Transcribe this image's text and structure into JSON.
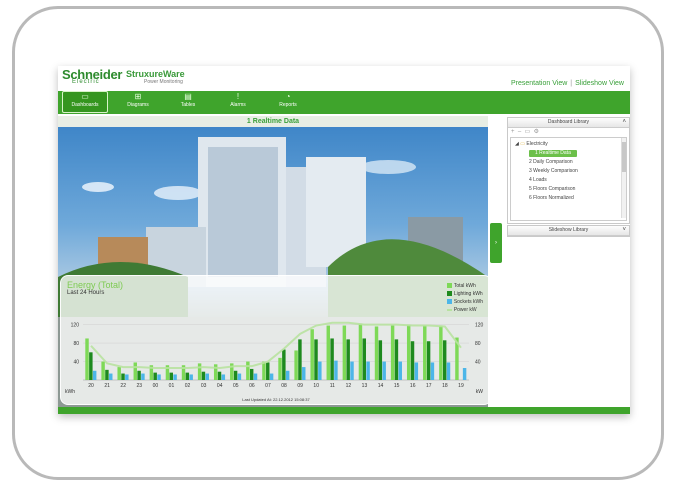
{
  "header": {
    "logo_primary": "Schneider",
    "logo_primary_sub": "Electric",
    "logo_secondary": "StruxureWare",
    "logo_secondary_sub": "Power Monitoring",
    "view_links": [
      "Presentation View",
      "Slideshow View"
    ]
  },
  "nav": {
    "items": [
      {
        "label": "Dashboards",
        "icon": "dashboard-icon",
        "active": true
      },
      {
        "label": "Diagrams",
        "icon": "diagram-icon",
        "active": false
      },
      {
        "label": "Tables",
        "icon": "table-icon",
        "active": false
      },
      {
        "label": "Alarms",
        "icon": "alarm-icon",
        "active": false
      },
      {
        "label": "Reports",
        "icon": "reports-icon",
        "active": false
      }
    ]
  },
  "content": {
    "title": "1 Realtime Data"
  },
  "dashboard_library": {
    "header": "Dashboard Library",
    "folder": "Electricity",
    "items": [
      {
        "label": "1 Realtime Data",
        "selected": true
      },
      {
        "label": "2 Daily Comparison",
        "selected": false
      },
      {
        "label": "3 Weekly Comparison",
        "selected": false
      },
      {
        "label": "4 Loads",
        "selected": false
      },
      {
        "label": "5 Floors Comparison",
        "selected": false
      },
      {
        "label": "6 Floors Normalized",
        "selected": false
      }
    ]
  },
  "slideshow_library": {
    "header": "Slideshow Library"
  },
  "colors": {
    "brand_green": "#3fa42c",
    "total": "#7ed957",
    "lighting": "#1e8a1e",
    "sockets": "#4cb6e8",
    "power": "#b8e2a0"
  },
  "chart_data": {
    "type": "bar",
    "title": "Energy (Total)",
    "subtitle": "Last 24 Hours",
    "ylabel_left": "kWh",
    "ylabel_right": "kW",
    "ylim": [
      0,
      130
    ],
    "yticks_left": [
      40,
      80,
      120
    ],
    "yticks_right": [
      40,
      80,
      120
    ],
    "footer": "Last Updated At: 22.12.2012 15:08:37",
    "categories": [
      "20",
      "21",
      "22",
      "23",
      "00",
      "01",
      "02",
      "03",
      "04",
      "05",
      "06",
      "07",
      "08",
      "09",
      "10",
      "11",
      "12",
      "13",
      "14",
      "15",
      "16",
      "17",
      "18",
      "19"
    ],
    "series": [
      {
        "name": "Total kWh",
        "values": [
          90,
          40,
          28,
          38,
          32,
          32,
          32,
          36,
          34,
          36,
          40,
          40,
          48,
          64,
          110,
          118,
          118,
          122,
          116,
          118,
          120,
          118,
          118,
          92
        ]
      },
      {
        "name": "Lighting kWh",
        "values": [
          60,
          22,
          14,
          20,
          16,
          16,
          16,
          18,
          18,
          20,
          24,
          38,
          66,
          88,
          88,
          90,
          88,
          90,
          86,
          88,
          84,
          84,
          86,
          0
        ]
      },
      {
        "name": "Sockets kWh",
        "values": [
          20,
          14,
          12,
          14,
          12,
          12,
          12,
          14,
          12,
          14,
          14,
          14,
          20,
          28,
          40,
          42,
          40,
          40,
          40,
          40,
          38,
          38,
          38,
          26
        ]
      },
      {
        "name": "Power kW",
        "values": [
          74,
          36,
          28,
          28,
          26,
          26,
          26,
          28,
          26,
          30,
          30,
          40,
          68,
          100,
          118,
          124,
          124,
          120,
          120,
          120,
          118,
          118,
          116,
          70
        ]
      }
    ]
  }
}
